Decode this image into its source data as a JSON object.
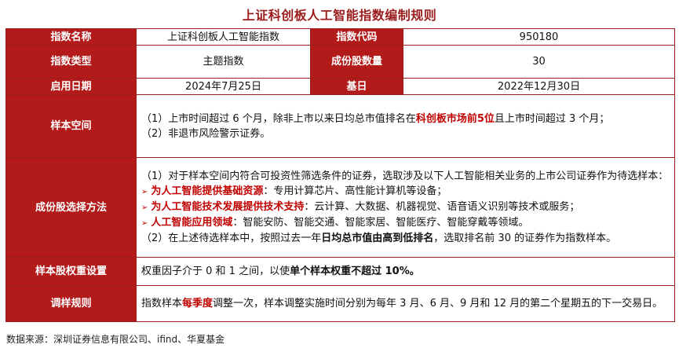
{
  "title": "上证科创板人工智能指数编制规则",
  "rows": {
    "index_name": {
      "label": "指数名称",
      "value": "上证科创板人工智能指数"
    },
    "index_code": {
      "label": "指数代码",
      "value": "950180"
    },
    "index_type": {
      "label": "指数类型",
      "value": "主题指数"
    },
    "constituent_count": {
      "label": "成份股数量",
      "value": "30"
    },
    "launch_date": {
      "label": "启用日期",
      "value": "2024年7月25日"
    },
    "base_date": {
      "label": "基日",
      "value": "2022年12月30日"
    },
    "sample_space": {
      "label": "样本空间",
      "line1_a": "（1）上市时间超过 6 个月，除非上市以来日均总市值排名在",
      "line1_b": "科创板市场前5位",
      "line1_c": "且上市时间超过 3 个月；",
      "line2": "（2）非退市风险警示证券。"
    },
    "selection": {
      "label": "成份股选择方法",
      "intro": "（1）对于样本空间内符合可投资性筛选条件的证券，选取涉及以下人工智能相关业务的上市公司证券作为待选样本：",
      "bullet1_head": "为人工智能提供基础资源",
      "bullet1_body": "：专用计算芯片、高性能计算机等设备；",
      "bullet2_head": "为人工智能技术发展提供技术支持",
      "bullet2_body": "：云计算、大数据、机器视觉、语音语义识别等技术或服务；",
      "bullet3_head": "人工智能应用领域",
      "bullet3_body": "：智能安防、智能交通、智能家居、智能医疗、智能穿戴等领域。",
      "step2_a": "（2）在上述待选样本中，按照过去一年",
      "step2_b": "日均总市值由高到低排名",
      "step2_c": "，选取排名前 30 的证券作为指数样本。"
    },
    "weighting": {
      "label": "样本股权重设置",
      "text_a": "权重因子介于 0 和 1 之间，以使",
      "text_b": "单个样本权重不超过 10%。"
    },
    "rebalance": {
      "label": "调样规则",
      "text_a": "指数样本",
      "text_b": "每季度",
      "text_c": "调整一次，样本调整实施时间分别为每年 3 月、6 月、9 月和 12 月的第二个星期五的下一交易日。"
    }
  },
  "source": "数据来源：深圳证券信息有限公司、ifind、华夏基金",
  "colors": {
    "header_bg": "#b31b1b",
    "title": "#9b1c1c",
    "highlight": "#c00000"
  }
}
